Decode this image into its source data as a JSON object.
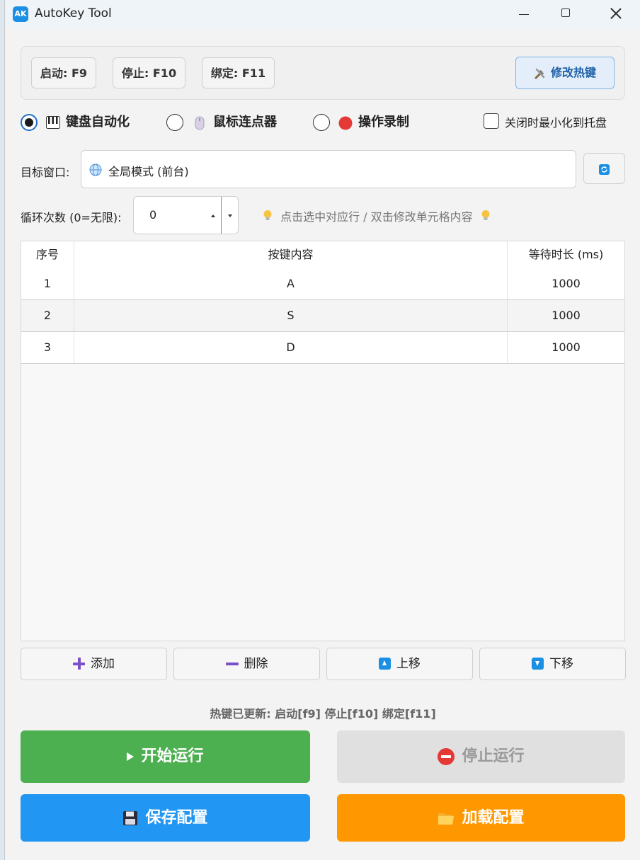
{
  "window": {
    "app_icon_text": "AK",
    "title": "AutoKey Tool"
  },
  "hotkeys": {
    "start": "启动: F9",
    "stop": "停止: F10",
    "bind": "绑定: F11",
    "edit_button": "修改热键"
  },
  "modes": {
    "keyboard": "键盘自动化",
    "mouse": "鼠标连点器",
    "record": "操作录制",
    "selected": "keyboard"
  },
  "minimize_to_tray": {
    "label": "关闭时最小化到托盘",
    "checked": false
  },
  "target": {
    "label": "目标窗口:",
    "value": "全局模式 (前台)"
  },
  "loop": {
    "label": "循环次数 (0=无限):",
    "value": "0",
    "tip": "点击选中对应行 / 双击修改单元格内容"
  },
  "table": {
    "headers": [
      "序号",
      "按键内容",
      "等待时长 (ms)"
    ],
    "rows": [
      [
        "1",
        "A",
        "1000"
      ],
      [
        "2",
        "S",
        "1000"
      ],
      [
        "3",
        "D",
        "1000"
      ]
    ]
  },
  "row_actions": {
    "add": "添加",
    "delete": "删除",
    "move_up": "上移",
    "move_down": "下移"
  },
  "status": "热键已更新: 启动[f9] 停止[f10] 绑定[f11]",
  "controls": {
    "start": "开始运行",
    "stop": "停止运行",
    "save": "保存配置",
    "load": "加载配置"
  },
  "colors": {
    "start_button": "#4caf50",
    "stop_button_disabled": "#e0e0e0",
    "save_button": "#2196f3",
    "load_button": "#ff9800",
    "accent": "#1a8fe3"
  }
}
